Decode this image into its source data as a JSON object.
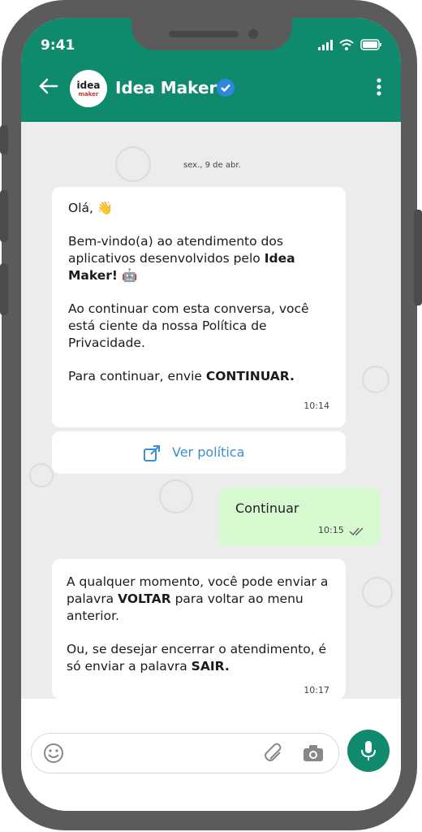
{
  "status": {
    "time": "9:41"
  },
  "contact": {
    "name": "Idea Maker",
    "avatar_text": "idea",
    "avatar_sub": "maker"
  },
  "chat": {
    "date": "sex., 9 de abr.",
    "msg1": {
      "p1": "Olá, 👋",
      "p2_a": "Bem-vindo(a) ao atendimento dos aplicativos desenvolvidos pelo",
      "p2_b": "Idea Maker!",
      "p2_emoji": "🤖",
      "p3": "Ao continuar com esta conversa, você está ciente da nossa Política de Privacidade.",
      "p4_a": "Para continuar, envie",
      "p4_b": "CONTINUAR.",
      "time": "10:14"
    },
    "link_label": "Ver política",
    "sent": {
      "text": "Continuar",
      "time": "10:15"
    },
    "msg2": {
      "p1_a": "A qualquer momento, você pode enviar a palavra",
      "p1_b": "VOLTAR",
      "p1_c": "para voltar ao menu anterior.",
      "p2_a": "Ou, se desejar encerrar o atendimento, é só enviar a palavra",
      "p2_b": "SAIR.",
      "time": "10:17"
    }
  },
  "icons": [
    "back-icon",
    "verified-icon",
    "menu-icon",
    "external-link-icon",
    "double-check-icon",
    "emoji-icon",
    "attach-icon",
    "camera-icon",
    "mic-icon"
  ],
  "colors": {
    "header": "#0f8a6d",
    "sent_bubble": "#d7f9cf",
    "link": "#3c8ecf"
  }
}
